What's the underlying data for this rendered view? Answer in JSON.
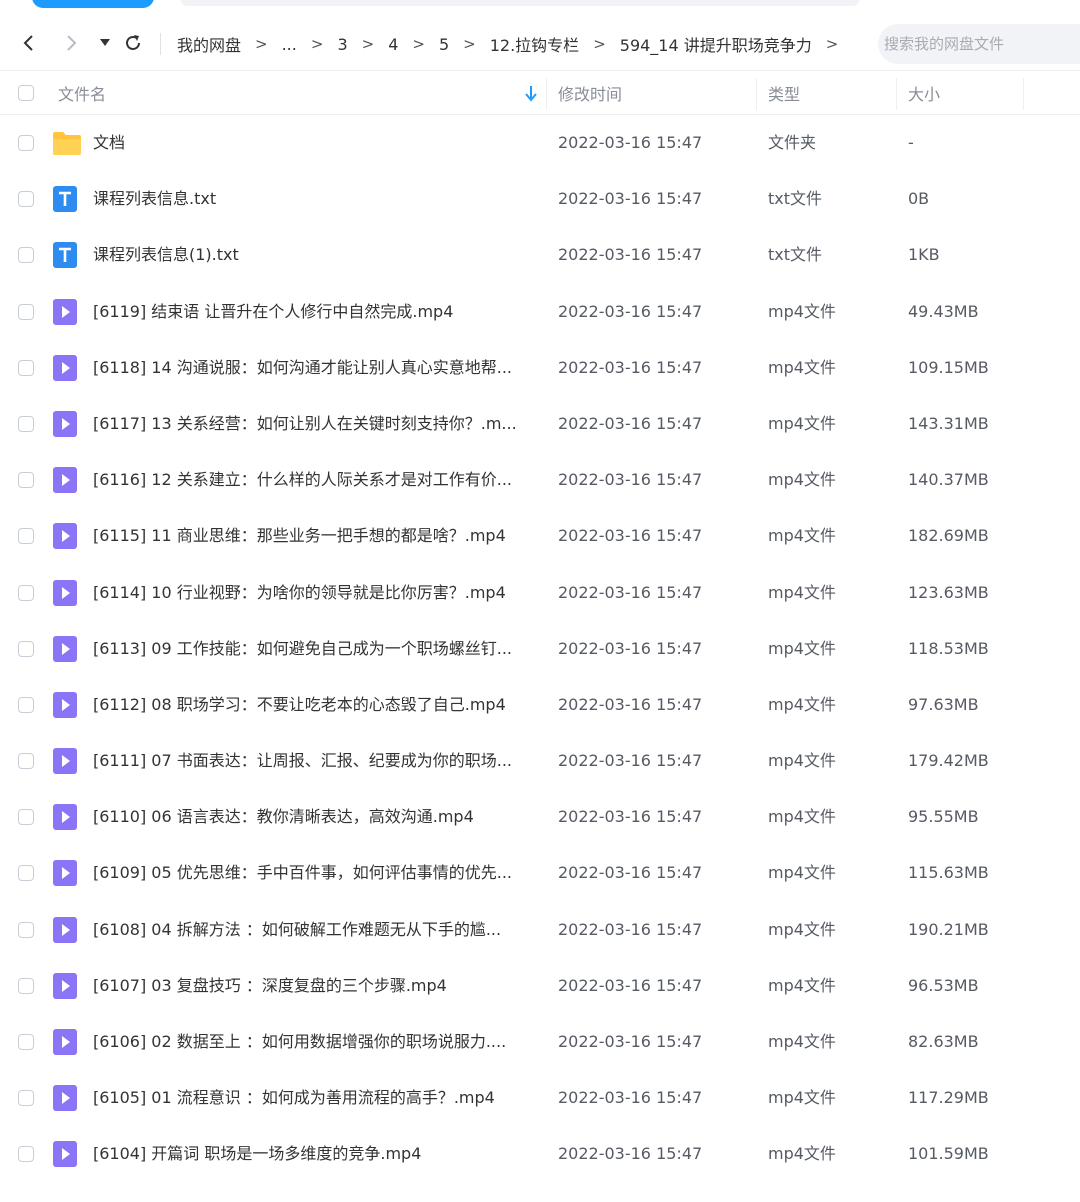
{
  "nav": {
    "breadcrumbs": [
      "我的网盘",
      "...",
      "3",
      "4",
      "5",
      "12.拉钩专栏",
      "594_14 讲提升职场竞争力"
    ],
    "separator": ">",
    "search_placeholder": "搜索我的网盘文件"
  },
  "header": {
    "name": "文件名",
    "modified": "修改时间",
    "type": "类型",
    "size": "大小"
  },
  "files": [
    {
      "name": "文档",
      "date": "2022-03-16 15:47",
      "type": "文件夹",
      "size": "-",
      "icon": "folder-icon"
    },
    {
      "name": "课程列表信息.txt",
      "date": "2022-03-16 15:47",
      "type": "txt文件",
      "size": "0B",
      "icon": "txt-file-icon"
    },
    {
      "name": "课程列表信息(1).txt",
      "date": "2022-03-16 15:47",
      "type": "txt文件",
      "size": "1KB",
      "icon": "txt-file-icon"
    },
    {
      "name": "[6119] 结束语  让晋升在个人修行中自然完成.mp4",
      "date": "2022-03-16 15:47",
      "type": "mp4文件",
      "size": "49.43MB",
      "icon": "video-file-icon"
    },
    {
      "name": "[6118] 14  沟通说服：如何沟通才能让别人真心实意地帮...",
      "date": "2022-03-16 15:47",
      "type": "mp4文件",
      "size": "109.15MB",
      "icon": "video-file-icon"
    },
    {
      "name": "[6117] 13  关系经营：如何让别人在关键时刻支持你？.m...",
      "date": "2022-03-16 15:47",
      "type": "mp4文件",
      "size": "143.31MB",
      "icon": "video-file-icon"
    },
    {
      "name": "[6116] 12  关系建立：什么样的人际关系才是对工作有价...",
      "date": "2022-03-16 15:47",
      "type": "mp4文件",
      "size": "140.37MB",
      "icon": "video-file-icon"
    },
    {
      "name": "[6115] 11  商业思维：那些业务一把手想的都是啥？.mp4",
      "date": "2022-03-16 15:47",
      "type": "mp4文件",
      "size": "182.69MB",
      "icon": "video-file-icon"
    },
    {
      "name": "[6114] 10  行业视野：为啥你的领导就是比你厉害？.mp4",
      "date": "2022-03-16 15:47",
      "type": "mp4文件",
      "size": "123.63MB",
      "icon": "video-file-icon"
    },
    {
      "name": "[6113] 09  工作技能：如何避免自己成为一个职场螺丝钉...",
      "date": "2022-03-16 15:47",
      "type": "mp4文件",
      "size": "118.53MB",
      "icon": "video-file-icon"
    },
    {
      "name": "[6112] 08  职场学习：不要让吃老本的心态毁了自己.mp4",
      "date": "2022-03-16 15:47",
      "type": "mp4文件",
      "size": "97.63MB",
      "icon": "video-file-icon"
    },
    {
      "name": "[6111] 07  书面表达：让周报、汇报、纪要成为你的职场...",
      "date": "2022-03-16 15:47",
      "type": "mp4文件",
      "size": "179.42MB",
      "icon": "video-file-icon"
    },
    {
      "name": "[6110] 06  语言表达：教你清晰表达，高效沟通.mp4",
      "date": "2022-03-16 15:47",
      "type": "mp4文件",
      "size": "95.55MB",
      "icon": "video-file-icon"
    },
    {
      "name": "[6109] 05  优先思维：手中百件事，如何评估事情的优先...",
      "date": "2022-03-16 15:47",
      "type": "mp4文件",
      "size": "115.63MB",
      "icon": "video-file-icon"
    },
    {
      "name": "[6108] 04  拆解方法 ：如何破解工作难题无从下手的尴...",
      "date": "2022-03-16 15:47",
      "type": "mp4文件",
      "size": "190.21MB",
      "icon": "video-file-icon"
    },
    {
      "name": "[6107] 03  复盘技巧 ：深度复盘的三个步骤.mp4",
      "date": "2022-03-16 15:47",
      "type": "mp4文件",
      "size": "96.53MB",
      "icon": "video-file-icon"
    },
    {
      "name": "[6106] 02  数据至上 ：如何用数据增强你的职场说服力....",
      "date": "2022-03-16 15:47",
      "type": "mp4文件",
      "size": "82.63MB",
      "icon": "video-file-icon"
    },
    {
      "name": "[6105] 01  流程意识 ：如何成为善用流程的高手？.mp4",
      "date": "2022-03-16 15:47",
      "type": "mp4文件",
      "size": "117.29MB",
      "icon": "video-file-icon"
    },
    {
      "name": "[6104] 开篇词  职场是一场多维度的竞争.mp4",
      "date": "2022-03-16 15:47",
      "type": "mp4文件",
      "size": "101.59MB",
      "icon": "video-file-icon"
    }
  ],
  "colors": {
    "folder": "#ffc53d",
    "txt": "#2e8cf0",
    "video": "#8c74f6",
    "accent": "#1e9bff"
  }
}
